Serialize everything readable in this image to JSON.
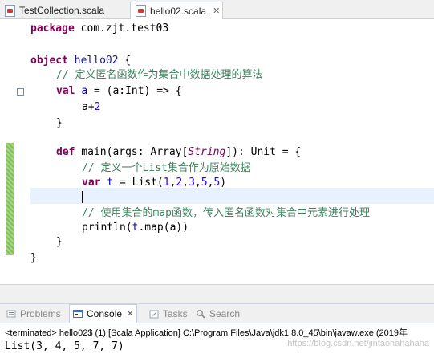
{
  "tabs": [
    {
      "label": "TestCollection.scala",
      "active": false
    },
    {
      "label": "hello02.scala",
      "active": true,
      "close": "✕"
    }
  ],
  "code": {
    "l1": [
      "package",
      " com.zjt.test03"
    ],
    "l3": [
      "object",
      " ",
      "hello02",
      " {"
    ],
    "l4": "// 定义匿名函数作为集合中数据处理的算法",
    "l5": [
      "val",
      " ",
      "a",
      " = (a:Int) => {"
    ],
    "l6": [
      "a+",
      "2"
    ],
    "l7": "}",
    "l9": [
      "def",
      " main(args: Array[",
      "String",
      "]): Unit = {"
    ],
    "l10": "// 定义一个List集合作为原始数据",
    "l11": [
      "var",
      " ",
      "t",
      " = List(",
      "1",
      ",",
      "2",
      ",",
      "3",
      ",",
      "5",
      ",",
      "5",
      ")"
    ],
    "l13": "// 使用集合的map函数，传入匿名函数对集合中元素进行处理",
    "l14": [
      "println(",
      "t",
      ".map(a))"
    ],
    "l15": "}",
    "l16": "}"
  },
  "views": {
    "problems": "Problems",
    "console": "Console",
    "console_close": "✕",
    "tasks": "Tasks",
    "search": "Search"
  },
  "console": {
    "terminated": "<terminated> hello02$ (1) [Scala Application] C:\\Program Files\\Java\\jdk1.8.0_45\\bin\\javaw.exe (2019年",
    "output": "List(3, 4, 5, 7, 7)",
    "watermark": "https://blog.csdn.net/jintaohahahaha"
  },
  "icons": {
    "file": "scala-file-icon",
    "problems": "problems-icon",
    "console": "console-icon",
    "tasks": "tasks-icon",
    "search": "search-icon"
  }
}
